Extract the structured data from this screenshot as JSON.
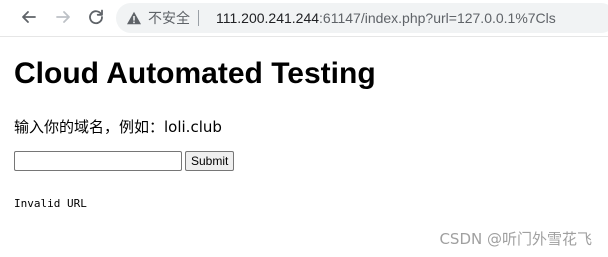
{
  "browser": {
    "security_label": "不安全",
    "url_host": "111.200.241.244",
    "url_rest": ":61147/index.php?url=127.0.0.1%7Cls",
    "icons": {
      "back": "arrow-left-icon",
      "forward": "arrow-right-icon",
      "reload": "reload-icon",
      "security": "warning-triangle-icon"
    }
  },
  "page": {
    "title": "Cloud Automated Testing",
    "prompt": "输入你的域名，例如：loli.club",
    "input_value": "",
    "submit_label": "Submit",
    "result": "Invalid URL"
  },
  "watermark": "CSDN @听门外雪花飞"
}
